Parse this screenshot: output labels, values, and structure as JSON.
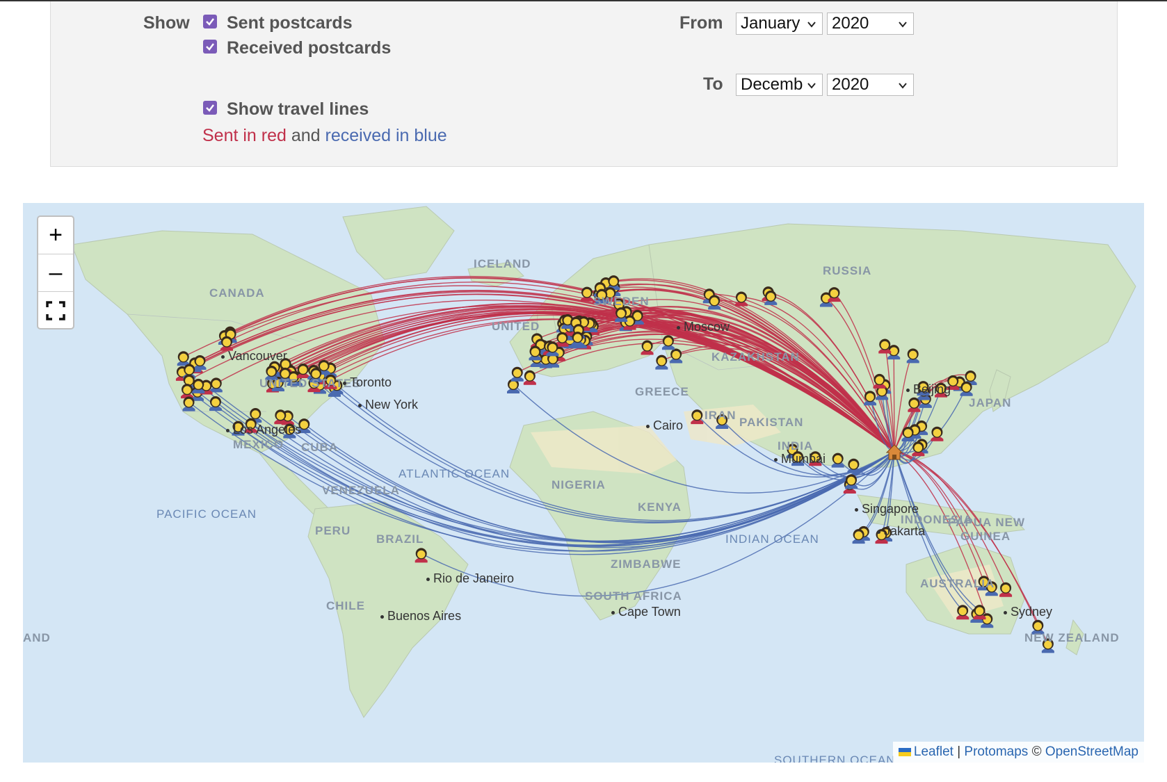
{
  "filters": {
    "show_label": "Show",
    "sent_label": "Sent postcards",
    "received_label": "Received postcards",
    "travel_label": "Show travel lines",
    "legend": {
      "sent": "Sent in red",
      "and": "and",
      "received": "received in blue"
    },
    "from_label": "From",
    "to_label": "To",
    "from_month": "January",
    "from_year": "2020",
    "to_month": "Decemb",
    "to_year": "2020",
    "sent_checked": true,
    "received_checked": true,
    "travel_checked": true
  },
  "map": {
    "zoom_in": "+",
    "zoom_out": "–",
    "attribution": {
      "leaflet": "Leaflet",
      "sep": " | ",
      "protomaps": "Protomaps",
      "copy": " © ",
      "osm": "OpenStreetMap"
    },
    "labels": {
      "canada": "CANADA",
      "russia": "RUSSIA",
      "iceland": "ICELAND",
      "united": "UNITED",
      "sweden": "SWEDEN",
      "kazakhstan": "KAZAKHSTAN",
      "iran": "IRAN",
      "pakistan": "PAKISTAN",
      "india": "INDIA",
      "mexico": "MEXICO",
      "cuba": "CUBA",
      "venezuela": "VENEZUELA",
      "peru": "PERU",
      "brazil": "BRAZIL",
      "chile": "CHILE",
      "nigeria": "NIGERIA",
      "kenya": "KENYA",
      "zimbabwe": "ZIMBABWE",
      "south_africa": "SOUTH AFRICA",
      "australia": "AUSTRALIA",
      "indonesia": "INDONESIA",
      "papua": "PAPUA NEW",
      "guinea": "GUINEA",
      "new_zealand": "NEW ZEALAND",
      "japan": "JAPAN",
      "usa": "UNITED STATES",
      "greece": "GREECE",
      "and": "AND"
    },
    "oceans": {
      "pacific": "PACIFIC OCEAN",
      "atlantic": "ATLANTIC OCEAN",
      "indian": "INDIAN OCEAN",
      "southern": "SOUTHERN OCEAN"
    },
    "cities": {
      "vancouver": "Vancouver",
      "new_york": "New York",
      "los_angeles": "Los Angeles",
      "moscow": "Moscow",
      "cairo": "Cairo",
      "mumbai": "Mumbai",
      "singapore": "Singapore",
      "jakarta": "Jakarta",
      "beijing": "Beijing",
      "sydney": "Sydney",
      "rio": "Rio de Janeiro",
      "buenos_aires": "Buenos Aires",
      "cape_town": "Cape Town",
      "toronto": "Toronto"
    },
    "colors": {
      "sent": "#c0304a",
      "received": "#4a6ab0",
      "water": "#d4e6f5",
      "land": "#cfe3c2",
      "desert": "#efe8c8"
    },
    "icons": {
      "marker": "person-icon",
      "home": "home-icon",
      "fullscreen": "fullscreen-icon"
    }
  }
}
